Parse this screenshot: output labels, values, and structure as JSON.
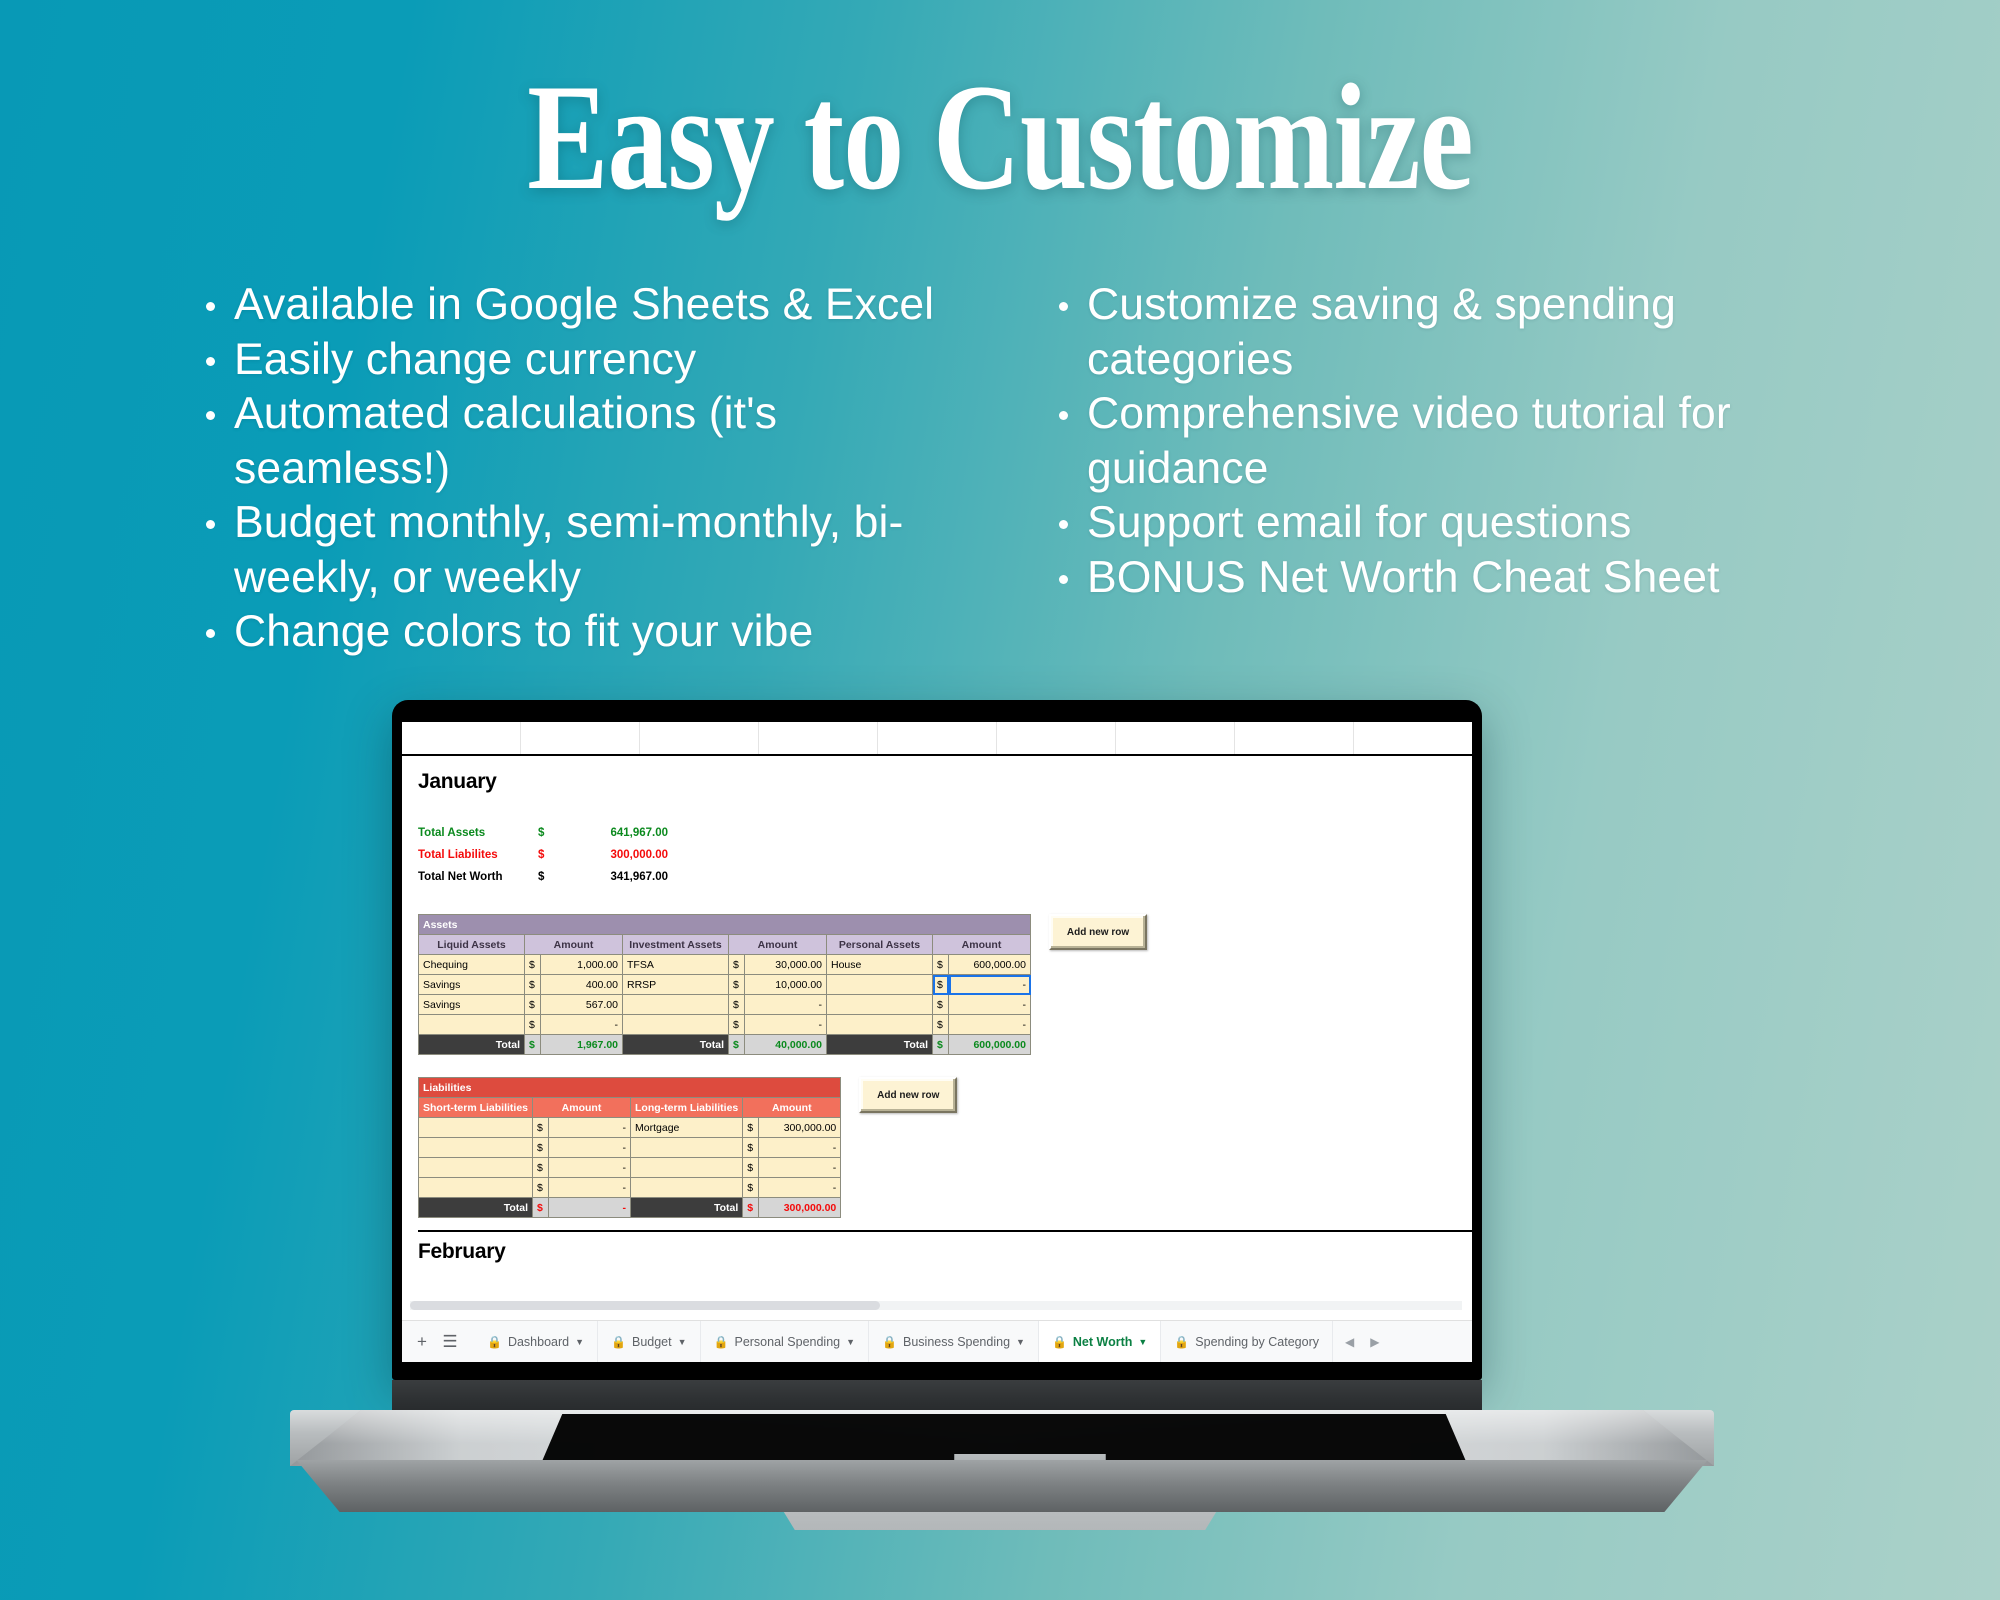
{
  "page": {
    "headline": "Easy to Customize",
    "background_left": "#0899b6",
    "background_right": "#abd1c9"
  },
  "bullets": {
    "left_column": [
      "Available in Google Sheets & Excel",
      "Easily change currency",
      "Automated calculations (it's seamless!)",
      "Budget monthly, semi-monthly, bi-weekly, or weekly",
      "Change colors to fit your vibe"
    ],
    "right_column": [
      "Customize saving & spending categories",
      "Comprehensive video tutorial for guidance",
      "Support email for questions",
      "BONUS Net Worth Cheat Sheet"
    ]
  },
  "spreadsheet": {
    "month_title": "January",
    "next_month_title": "February",
    "summary": [
      {
        "label": "Total Assets",
        "currency": "$",
        "value": "641,967.00",
        "color": "#0b8a1e"
      },
      {
        "label": "Total Liabilites",
        "currency": "$",
        "value": "300,000.00",
        "color": "#f40b0b"
      },
      {
        "label": "Total Net Worth",
        "currency": "$",
        "value": "341,967.00",
        "color": "#000000"
      }
    ],
    "assets": {
      "band_label": "Assets",
      "headers": [
        "Liquid Assets",
        "Amount",
        "Investment Assets",
        "Amount",
        "Personal Assets",
        "Amount"
      ],
      "rows": [
        {
          "liquid": "Chequing",
          "liquid_cur": "$",
          "liquid_amt": "1,000.00",
          "invest": "TFSA",
          "invest_cur": "$",
          "invest_amt": "30,000.00",
          "personal": "House",
          "personal_cur": "$",
          "personal_amt": "600,000.00"
        },
        {
          "liquid": "Savings",
          "liquid_cur": "$",
          "liquid_amt": "400.00",
          "invest": "RRSP",
          "invest_cur": "$",
          "invest_amt": "10,000.00",
          "personal": "",
          "personal_cur": "$",
          "personal_amt": "-"
        },
        {
          "liquid": "Savings",
          "liquid_cur": "$",
          "liquid_amt": "567.00",
          "invest": "",
          "invest_cur": "$",
          "invest_amt": "-",
          "personal": "",
          "personal_cur": "$",
          "personal_amt": "-"
        },
        {
          "liquid": "",
          "liquid_cur": "$",
          "liquid_amt": "-",
          "invest": "",
          "invest_cur": "$",
          "invest_amt": "-",
          "personal": "",
          "personal_cur": "$",
          "personal_amt": "-"
        }
      ],
      "total_label": "Total",
      "totals": [
        {
          "currency": "$",
          "value": "1,967.00"
        },
        {
          "currency": "$",
          "value": "40,000.00"
        },
        {
          "currency": "$",
          "value": "600,000.00"
        }
      ],
      "add_row_button": "Add new row"
    },
    "liabilities": {
      "band_label": "Liabilities",
      "headers": [
        "Short-term Liabilities",
        "Amount",
        "Long-term Liabilities",
        "Amount"
      ],
      "rows": [
        {
          "short": "",
          "short_cur": "$",
          "short_amt": "-",
          "long": "Mortgage",
          "long_cur": "$",
          "long_amt": "300,000.00"
        },
        {
          "short": "",
          "short_cur": "$",
          "short_amt": "-",
          "long": "",
          "long_cur": "$",
          "long_amt": "-"
        },
        {
          "short": "",
          "short_cur": "$",
          "short_amt": "-",
          "long": "",
          "long_cur": "$",
          "long_amt": "-"
        },
        {
          "short": "",
          "short_cur": "$",
          "short_amt": "-",
          "long": "",
          "long_cur": "$",
          "long_amt": "-"
        }
      ],
      "total_label": "Total",
      "totals": [
        {
          "currency": "$",
          "value": "-"
        },
        {
          "currency": "$",
          "value": "300,000.00"
        }
      ],
      "add_row_button": "Add new row"
    },
    "tabbar": {
      "add_sheet_icon": "plus-icon",
      "all_sheets_icon": "list-icon",
      "tabs": [
        {
          "label": "Dashboard",
          "locked": true,
          "active": false,
          "has_caret": true
        },
        {
          "label": "Budget",
          "locked": true,
          "active": false,
          "has_caret": true
        },
        {
          "label": "Personal Spending",
          "locked": true,
          "active": false,
          "has_caret": true
        },
        {
          "label": "Business Spending",
          "locked": true,
          "active": false,
          "has_caret": true
        },
        {
          "label": "Net Worth",
          "locked": true,
          "active": true,
          "has_caret": true
        },
        {
          "label": "Spending by Category",
          "locked": true,
          "active": false,
          "has_caret": false
        }
      ],
      "prev_arrow": "◀",
      "next_arrow": "▶",
      "active_tab_color": "#0b8043"
    }
  }
}
